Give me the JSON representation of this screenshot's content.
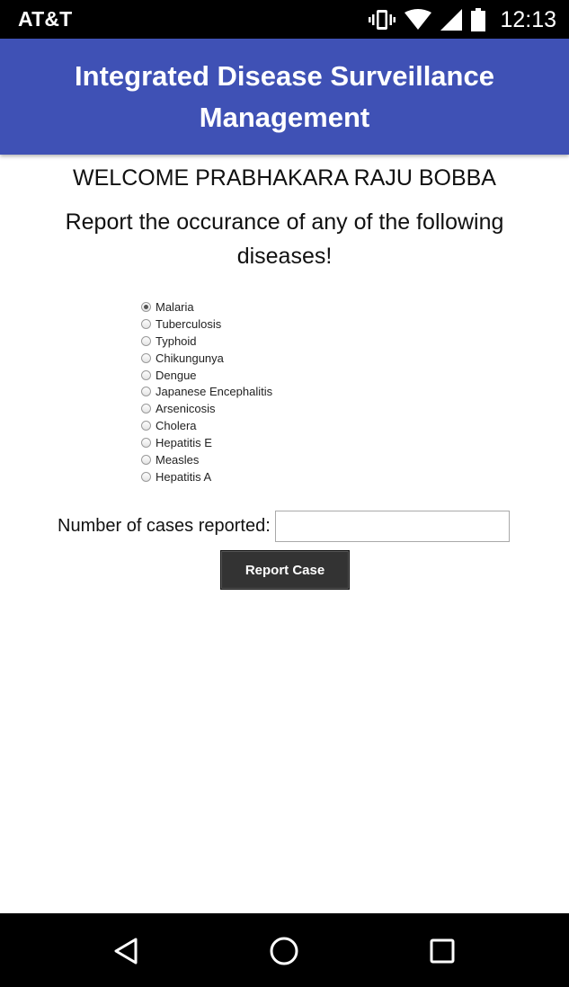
{
  "status_bar": {
    "carrier": "AT&T",
    "time": "12:13",
    "icons": [
      "vibrate-icon",
      "wifi-icon",
      "cell-signal-icon",
      "battery-icon"
    ]
  },
  "app_bar": {
    "title": "Integrated Disease Surveillance Management",
    "color": "#3f51b5"
  },
  "main": {
    "welcome": "WELCOME PRABHAKARA RAJU BOBBA",
    "prompt": "Report the occurance of any of the following diseases!",
    "diseases": [
      {
        "label": "Malaria",
        "checked": true
      },
      {
        "label": "Tuberculosis",
        "checked": false
      },
      {
        "label": "Typhoid",
        "checked": false
      },
      {
        "label": "Chikungunya",
        "checked": false
      },
      {
        "label": "Dengue",
        "checked": false
      },
      {
        "label": "Japanese Encephalitis",
        "checked": false
      },
      {
        "label": "Arsenicosis",
        "checked": false
      },
      {
        "label": "Cholera",
        "checked": false
      },
      {
        "label": "Hepatitis E",
        "checked": false
      },
      {
        "label": "Measles",
        "checked": false
      },
      {
        "label": "Hepatitis A",
        "checked": false
      }
    ],
    "cases_label": "Number of cases reported:",
    "cases_value": "",
    "report_button": "Report Case"
  },
  "nav_bar": {
    "icons": [
      "back-icon",
      "home-icon",
      "recents-icon"
    ]
  }
}
